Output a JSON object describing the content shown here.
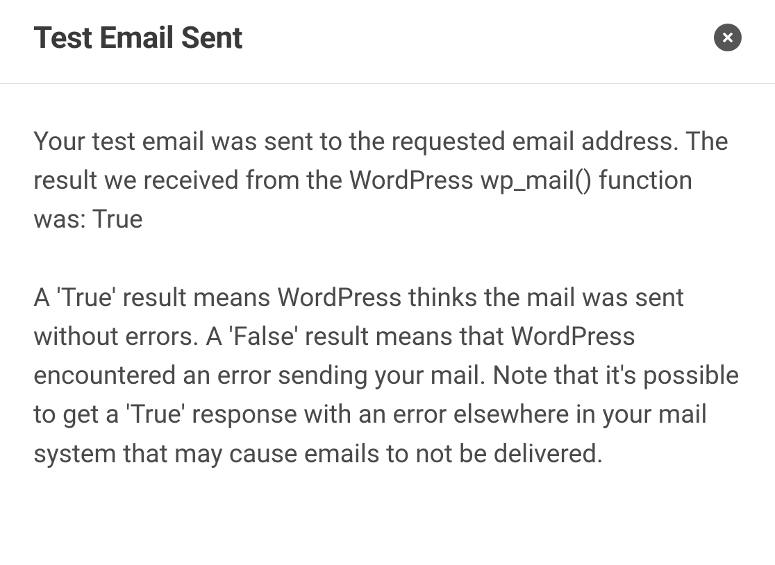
{
  "dialog": {
    "title": "Test Email Sent",
    "paragraph1": "Your test email was sent to the requested email address. The result we received from the WordPress wp_mail() function was: True",
    "paragraph2": "A 'True' result means WordPress thinks the mail was sent without errors. A 'False' result means that WordPress encountered an error sending your mail. Note that it's possible to get a 'True' response with an error elsewhere in your mail system that may cause emails to not be delivered."
  }
}
